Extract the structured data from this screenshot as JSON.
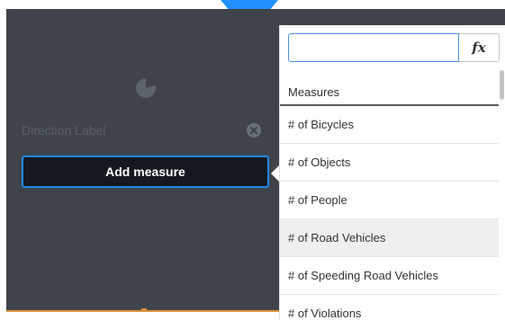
{
  "editor": {
    "label_text": "Direction Label",
    "add_measure_label": "Add measure"
  },
  "measure_picker": {
    "search_value": "",
    "search_placeholder": "",
    "fx_label": "fx",
    "section_title": "Measures",
    "items": [
      {
        "label": "# of Bicycles",
        "hovered": false
      },
      {
        "label": "# of Objects",
        "hovered": false
      },
      {
        "label": "# of People",
        "hovered": false
      },
      {
        "label": "# of Road Vehicles",
        "hovered": true
      },
      {
        "label": "# of Speeding Road Vehicles",
        "hovered": false
      },
      {
        "label": "# of Violations",
        "hovered": false
      }
    ]
  },
  "icons": {
    "chart": "pie-chart-icon",
    "remove": "close-circle-icon"
  },
  "colors": {
    "panel_bg": "#3f444b",
    "accent_blue": "#1e88e5",
    "button_bg": "#15191f",
    "hover_row": "#efefef",
    "orange_line": "#d9903a"
  }
}
